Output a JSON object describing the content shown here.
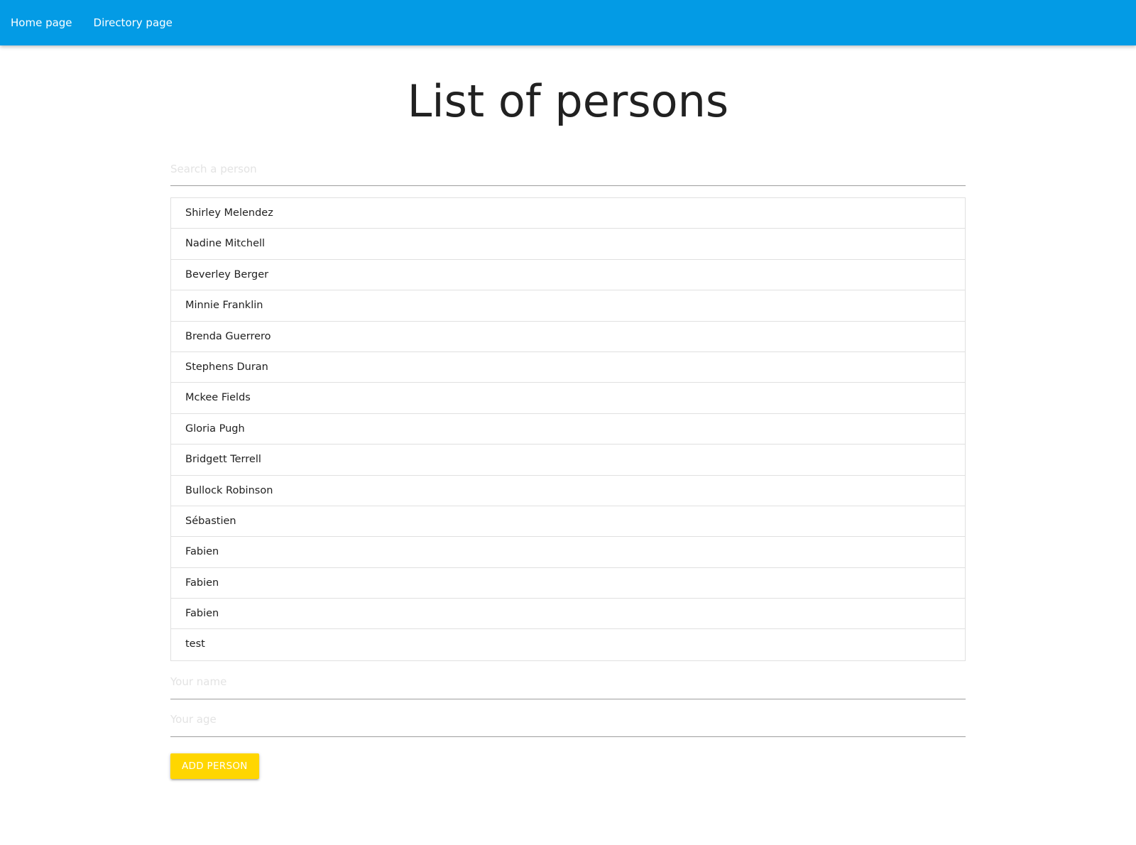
{
  "nav": {
    "links": [
      {
        "label": "Home page"
      },
      {
        "label": "Directory page"
      }
    ]
  },
  "main": {
    "title": "List of persons",
    "search": {
      "placeholder": "Search a person",
      "value": ""
    },
    "persons": [
      "Shirley Melendez",
      "Nadine Mitchell",
      "Beverley Berger",
      "Minnie Franklin",
      "Brenda Guerrero",
      "Stephens Duran",
      "Mckee Fields",
      "Gloria Pugh",
      "Bridgett Terrell",
      "Bullock Robinson",
      "Sébastien",
      "Fabien",
      "Fabien",
      "Fabien",
      "test"
    ],
    "form": {
      "name_placeholder": "Your name",
      "age_placeholder": "Your age",
      "add_label": "Add person"
    }
  },
  "colors": {
    "navbar": "#039be5",
    "button": "#ffd600"
  }
}
